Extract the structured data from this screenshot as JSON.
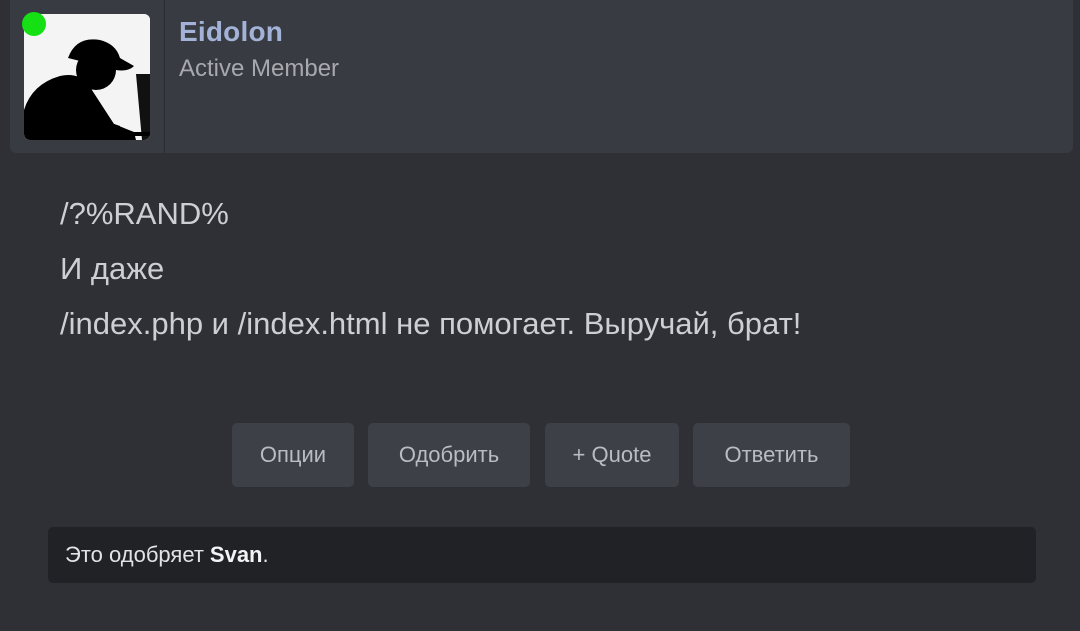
{
  "user": {
    "name": "Eidolon",
    "title": "Active Member",
    "online_color": "#14e014",
    "name_color": "#a3b3d8"
  },
  "message": {
    "lines": [
      "/?%RAND%",
      "И даже",
      "/index.php и /index.html не помогает. Выручай, брат!"
    ]
  },
  "actions": {
    "options": "Опции",
    "approve": "Одобрить",
    "quote": "+ Quote",
    "reply": "Ответить"
  },
  "likes": {
    "prefix": "Это одобряет",
    "user": "Svan",
    "suffix": "."
  },
  "colors": {
    "background": "#2e3036",
    "header": "#393b42",
    "button": "#3d4047",
    "likes_bar": "#212226"
  }
}
